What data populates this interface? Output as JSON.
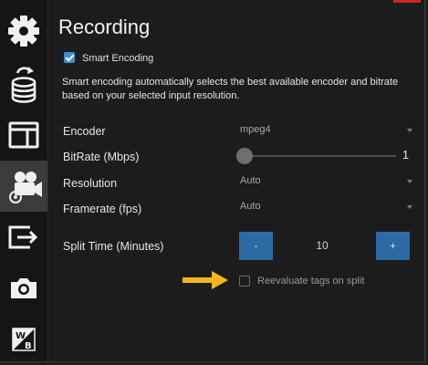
{
  "header": {
    "title": "Recording"
  },
  "smart_encoding": {
    "label": "Smart Encoding",
    "checked": true,
    "description": "Smart encoding automatically selects the best available encoder and bitrate based on your selected input resolution."
  },
  "encoder": {
    "label": "Encoder",
    "value": "mpeg4"
  },
  "bitrate": {
    "label": "BitRate (Mbps)",
    "value": "1",
    "level": 0
  },
  "resolution": {
    "label": "Resolution",
    "value": "Auto"
  },
  "framerate": {
    "label": "Framerate (fps)",
    "value": "Auto"
  },
  "split_time": {
    "label": "Split Time (Minutes)",
    "value": "10",
    "minus_label": "-",
    "plus_label": "+"
  },
  "reevaluate_tags": {
    "label": "Reevaluate tags on split",
    "checked": false
  },
  "sidebar": {
    "items": [
      {
        "icon": "gear-icon",
        "active": false
      },
      {
        "icon": "database-refresh-icon",
        "active": false
      },
      {
        "icon": "layout-icon",
        "active": false
      },
      {
        "icon": "video-camera-settings-icon",
        "active": true
      },
      {
        "icon": "export-icon",
        "active": false
      },
      {
        "icon": "camera-icon",
        "active": false
      },
      {
        "icon": "white-balance-icon",
        "active": false
      }
    ]
  },
  "colors": {
    "accent": "#3c8fd0",
    "button": "#2d6aa3",
    "annotation_arrow": "#f2b71e",
    "close_strip": "#c42b1c"
  }
}
